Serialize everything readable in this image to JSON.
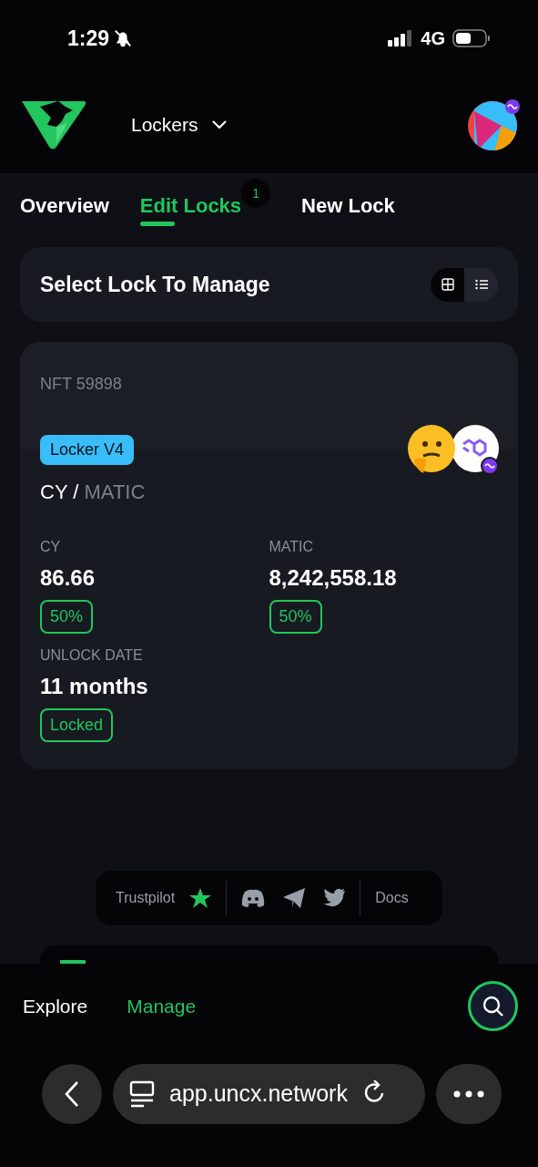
{
  "status_bar": {
    "time": "1:29",
    "network": "4G"
  },
  "header": {
    "menu_label": "Lockers"
  },
  "tabs": [
    {
      "label": "Overview",
      "selected": false
    },
    {
      "label": "Edit Locks",
      "selected": true,
      "badge": "1"
    },
    {
      "label": "New Lock",
      "selected": false
    }
  ],
  "panel": {
    "title": "Select Lock To Manage",
    "view_toggle": [
      {
        "kind": "grid",
        "selected": true
      },
      {
        "kind": "list",
        "selected": false
      }
    ]
  },
  "lock": {
    "nft": "NFT 59898",
    "version": "Locker V4",
    "pair": {
      "base": "CY",
      "separator": "/",
      "quote": "MATIC"
    },
    "amounts": [
      {
        "label": "CY",
        "value": "86.66",
        "share": "50%"
      },
      {
        "label": "MATIC",
        "value": "8,242,558.18",
        "share": "50%"
      }
    ],
    "unlock": {
      "label": "UNLOCK DATE",
      "value": "11 months",
      "status": "Locked"
    }
  },
  "footer": {
    "trustpilot": "Trustpilot",
    "docs": "Docs"
  },
  "bottom_nav": [
    {
      "label": "Explore",
      "selected": false
    },
    {
      "label": "Manage",
      "selected": true
    }
  ],
  "browser": {
    "url": "app.uncx.network"
  }
}
